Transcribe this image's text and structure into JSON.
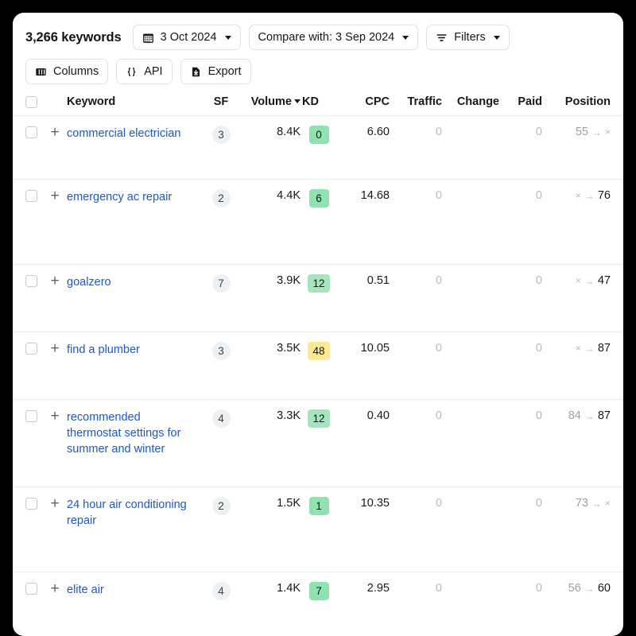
{
  "toolbar": {
    "keyword_count": "3,266 keywords",
    "date_button": "3 Oct 2024",
    "compare_button": "Compare with: 3 Sep 2024",
    "filters_button": "Filters",
    "columns_button": "Columns",
    "api_button": "API",
    "export_button": "Export",
    "icons": {
      "calendar": "calendar-icon",
      "filter": "filter-icon",
      "columns": "columns-icon",
      "api": "braces-icon",
      "export": "download-file-icon"
    }
  },
  "table": {
    "headers": {
      "keyword": "Keyword",
      "sf": "SF",
      "volume": "Volume",
      "kd": "KD",
      "cpc": "CPC",
      "traffic": "Traffic",
      "change": "Change",
      "paid": "Paid",
      "position": "Position"
    },
    "sort": {
      "column": "Volume",
      "direction": "desc"
    },
    "rows": [
      {
        "keyword": "commercial electrician",
        "sf": "3",
        "volume": "8.4K",
        "kd": "0",
        "kd_color": "#8fe3b0",
        "cpc": "6.60",
        "traffic": "0",
        "change": "",
        "paid": "0",
        "position_from": "55",
        "position_to": "×"
      },
      {
        "keyword": "emergency ac repair",
        "sf": "2",
        "volume": "4.4K",
        "kd": "6",
        "kd_color": "#8fe3b0",
        "cpc": "14.68",
        "traffic": "0",
        "change": "",
        "paid": "0",
        "position_from": "×",
        "position_to": "76"
      },
      {
        "keyword": "goalzero",
        "sf": "7",
        "volume": "3.9K",
        "kd": "12",
        "kd_color": "#a5e5bd",
        "cpc": "0.51",
        "traffic": "0",
        "change": "",
        "paid": "0",
        "position_from": "×",
        "position_to": "47"
      },
      {
        "keyword": "find a plumber",
        "sf": "3",
        "volume": "3.5K",
        "kd": "48",
        "kd_color": "#fce996",
        "cpc": "10.05",
        "traffic": "0",
        "change": "",
        "paid": "0",
        "position_from": "×",
        "position_to": "87"
      },
      {
        "keyword": "recommended thermostat settings for summer and winter",
        "sf": "4",
        "volume": "3.3K",
        "kd": "12",
        "kd_color": "#a5e5bd",
        "cpc": "0.40",
        "traffic": "0",
        "change": "",
        "paid": "0",
        "position_from": "84",
        "position_to": "87"
      },
      {
        "keyword": "24 hour air conditioning repair",
        "sf": "2",
        "volume": "1.5K",
        "kd": "1",
        "kd_color": "#8fe3b0",
        "cpc": "10.35",
        "traffic": "0",
        "change": "",
        "paid": "0",
        "position_from": "73",
        "position_to": "×"
      },
      {
        "keyword": "elite air",
        "sf": "4",
        "volume": "1.4K",
        "kd": "7",
        "kd_color": "#8fe3b0",
        "cpc": "2.95",
        "traffic": "0",
        "change": "",
        "paid": "0",
        "position_from": "56",
        "position_to": "60"
      }
    ]
  },
  "colors": {
    "link": "#1c59c7",
    "muted": "#b4babf",
    "kd_green": "#8fe3b0",
    "kd_yellow": "#fce996"
  }
}
